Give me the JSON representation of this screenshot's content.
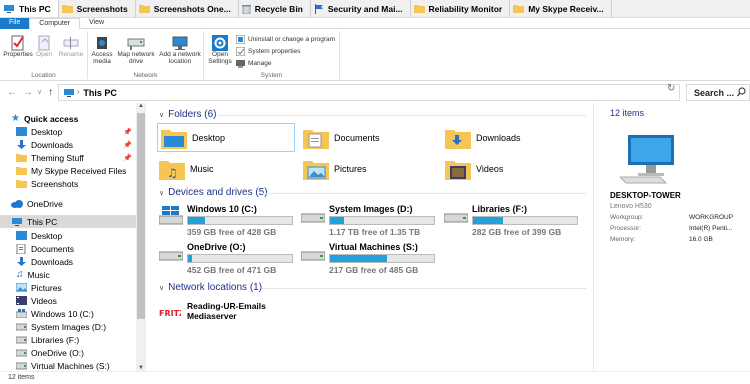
{
  "quick_tabs": [
    {
      "label": "This PC",
      "icon": "pc-icon"
    },
    {
      "label": "Screenshots",
      "icon": "folder-icon"
    },
    {
      "label": "Screenshots One...",
      "icon": "folder-icon"
    },
    {
      "label": "Recycle Bin",
      "icon": "recycle-bin-icon"
    },
    {
      "label": "Security and Mai...",
      "icon": "flag-icon"
    },
    {
      "label": "Reliability Monitor",
      "icon": "folder-icon"
    },
    {
      "label": "My Skype Receiv...",
      "icon": "folder-icon"
    }
  ],
  "ribbon_tabs": {
    "file": "File",
    "computer": "Computer",
    "view": "View"
  },
  "ribbon": {
    "location": {
      "label": "Location",
      "properties": "Properties",
      "open": "Open",
      "rename": "Rename"
    },
    "network": {
      "label": "Network",
      "access_media": "Access media",
      "map_drive": "Map network drive",
      "add_location": "Add a network location"
    },
    "system": {
      "label": "System",
      "open_settings": "Open Settings",
      "uninstall": "Uninstall or change a program",
      "system_properties": "System properties",
      "manage": "Manage"
    }
  },
  "address": {
    "path": "This PC",
    "search_placeholder": "Search ..."
  },
  "sidebar": {
    "quick_access": "Quick access",
    "qa_items": [
      "Desktop",
      "Downloads",
      "Theming Stuff",
      "My Skype Received Files",
      "Screenshots"
    ],
    "onedrive": "OneDrive",
    "this_pc": "This PC",
    "pc_items": [
      "Desktop",
      "Documents",
      "Downloads",
      "Music",
      "Pictures",
      "Videos",
      "Windows 10 (C:)",
      "System Images (D:)",
      "Libraries (F:)",
      "OneDrive (O:)",
      "Virtual Machines (S:)"
    ]
  },
  "folders": {
    "header": "Folders (6)",
    "items": [
      "Desktop",
      "Documents",
      "Downloads",
      "Music",
      "Pictures",
      "Videos"
    ]
  },
  "drives": {
    "header": "Devices and drives (5)",
    "items": [
      {
        "name": "Windows 10 (C:)",
        "free": "359 GB free of 428 GB",
        "used_fraction": 0.16
      },
      {
        "name": "System Images (D:)",
        "free": "1.17 TB free of 1.35 TB",
        "used_fraction": 0.13
      },
      {
        "name": "Libraries (F:)",
        "free": "282 GB free of 399 GB",
        "used_fraction": 0.29
      },
      {
        "name": "OneDrive (O:)",
        "free": "452 GB free of 471 GB",
        "used_fraction": 0.04
      },
      {
        "name": "Virtual Machines (S:)",
        "free": "217 GB free of 485 GB",
        "used_fraction": 0.55
      }
    ]
  },
  "network": {
    "header": "Network locations (1)",
    "item": "Reading-UR-Emails Mediaserver",
    "icon_text": "FRITZ!"
  },
  "details": {
    "count": "12 items",
    "name": "DESKTOP-TOWER",
    "model": "Lenovo H530",
    "rows": [
      {
        "key": "Workgroup:",
        "value": "WORKGROUP"
      },
      {
        "key": "Processor:",
        "value": "Intel(R) Penti..."
      },
      {
        "key": "Memory:",
        "value": "16.0 GB"
      }
    ]
  },
  "status": {
    "items": "12 items"
  },
  "colors": {
    "accent": "#1979ca",
    "bar_fill": "#26a0da",
    "header_blue": "#1e3287",
    "folder": "#f5c653"
  }
}
